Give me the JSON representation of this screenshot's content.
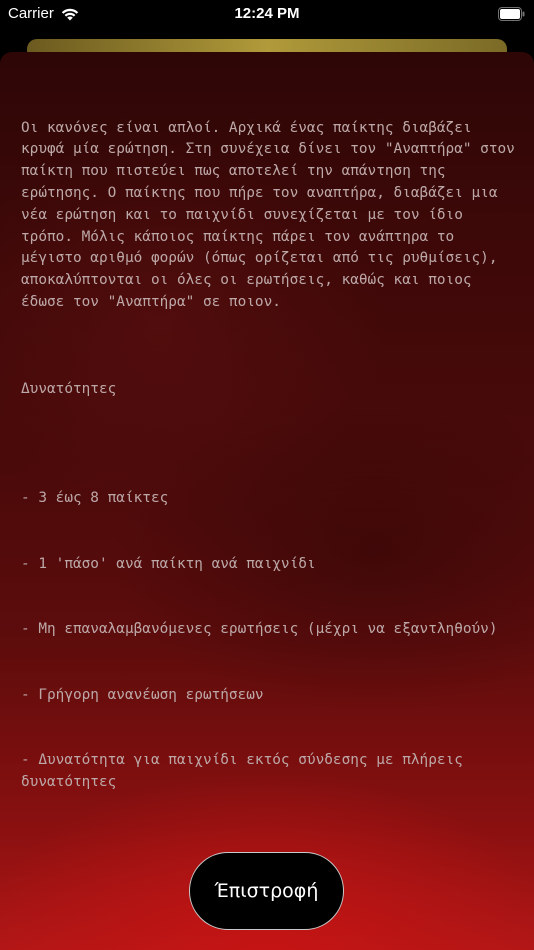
{
  "status_bar": {
    "carrier": "Carrier",
    "time": "12:24 PM"
  },
  "rules": {
    "paragraph": "Οι κανόνες είναι απλοί. Αρχικά ένας παίκτης διαβάζει κρυφά μία ερώτηση. Στη συνέχεια δίνει τον \"Αναπτήρα\" στον παίκτη που πιστεύει πως αποτελεί την απάντηση της ερώτησης. Ο παίκτης που πήρε τον αναπτήρα, διαβάζει μια νέα ερώτηση και το παιχνίδι συνεχίζεται με τον ίδιο τρόπο. Μόλις κάποιος παίκτης πάρει τον ανάπτηρα το μέγιστο αριθμό φορών (όπως ορίζεται από τις ρυθμίσεις), αποκαλύπτονται οι όλες οι ερωτήσεις, καθώς και ποιος έδωσε τον \"Αναπτήρα\" σε ποιον.",
    "features_title": "Δυνατότητες",
    "features": [
      "- 3 έως 8 παίκτες",
      "- 1 'πάσο' ανά παίκτη ανά παιχνίδι",
      "- Μη επαναλαμβανόμενες ερωτήσεις (μέχρι να εξαντληθούν)",
      "- Γρήγορη ανανέωση ερωτήσεων",
      "- Δυνατότητα για παιχνίδι εκτός σύνδεσης με πλήρεις δυνατότητες"
    ]
  },
  "back_button": {
    "label": "Έπιστροφή"
  },
  "colors": {
    "text": "#bda8a8",
    "button_bg": "#000000",
    "button_border": "#c9c9c9",
    "sheet_top": "#2e0606",
    "sheet_bottom": "#b51717"
  }
}
